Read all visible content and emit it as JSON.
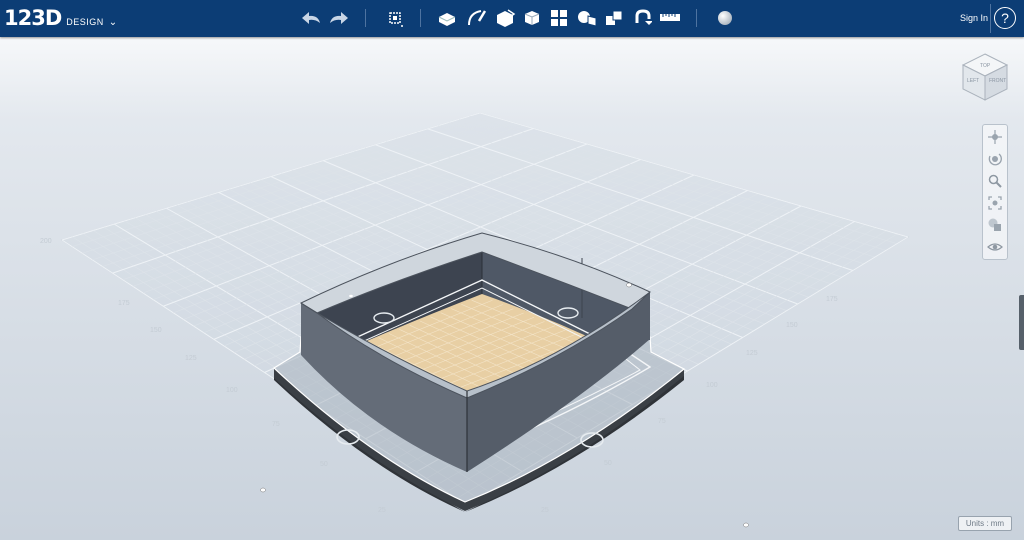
{
  "app": {
    "logo_main": "123D",
    "logo_sub": "DESIGN",
    "logo_chevron": "⌄"
  },
  "toolbar": {
    "items": [
      "undo-icon",
      "redo-icon",
      "transform-icon",
      "primitives-icon",
      "sketch-icon",
      "construct-icon",
      "modify-icon",
      "pattern-icon",
      "grouping-icon",
      "combine-icon",
      "snap-icon",
      "measure-icon",
      "material-icon"
    ]
  },
  "header": {
    "signin_label": "Sign In",
    "help_label": "?"
  },
  "viewcube": {
    "top": "TOP",
    "left": "LEFT",
    "front": "FRONT"
  },
  "navbar": {
    "items": [
      "pan-icon",
      "orbit-icon",
      "zoom-icon",
      "fit-icon",
      "view-mode-icon",
      "visibility-icon"
    ]
  },
  "grid": {
    "left_axis_ticks": [
      "200",
      "175",
      "150",
      "125",
      "100",
      "75",
      "50",
      "25"
    ],
    "right_axis_ticks": [
      "25",
      "50",
      "75",
      "100",
      "125",
      "150",
      "175"
    ]
  },
  "units_label": "Units : mm",
  "colors": {
    "toolbar_bg": "#0c3d75",
    "wall": "#5c6470",
    "base_plate": "#2f3338",
    "floor": "#e8cfa4"
  }
}
